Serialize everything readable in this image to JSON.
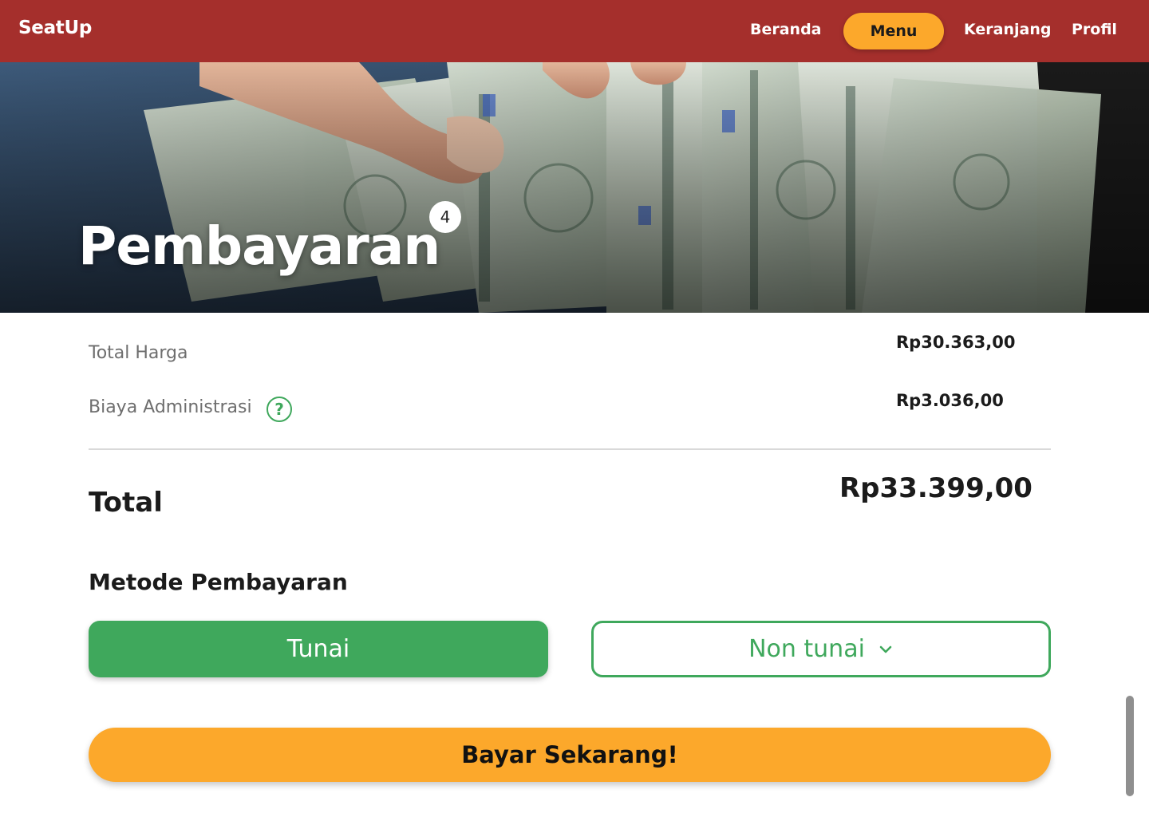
{
  "navbar": {
    "brand": "SeatUp",
    "links": [
      {
        "label": "Beranda"
      },
      {
        "label": "Menu",
        "active": true
      },
      {
        "label": "Keranjang"
      },
      {
        "label": "Profil"
      }
    ],
    "accent": "#a52f2c",
    "active_color": "#fca82b"
  },
  "hero": {
    "title": "Pembayaran",
    "badge": "4",
    "image": "dollar-bills-photo"
  },
  "summary": {
    "subtotal_label": "Total Harga",
    "subtotal_value": "Rp30.363,00",
    "admin_label": "Biaya Administrasi",
    "admin_value": "Rp3.036,00",
    "help_icon": "?",
    "total_label": "Total",
    "total_value": "Rp33.399,00"
  },
  "payment": {
    "title": "Metode Pembayaran",
    "cash_label": "Tunai",
    "noncash_label": "Non tunai",
    "pay_button": "Bayar Sekarang!",
    "primary_color": "#3fa85c"
  }
}
